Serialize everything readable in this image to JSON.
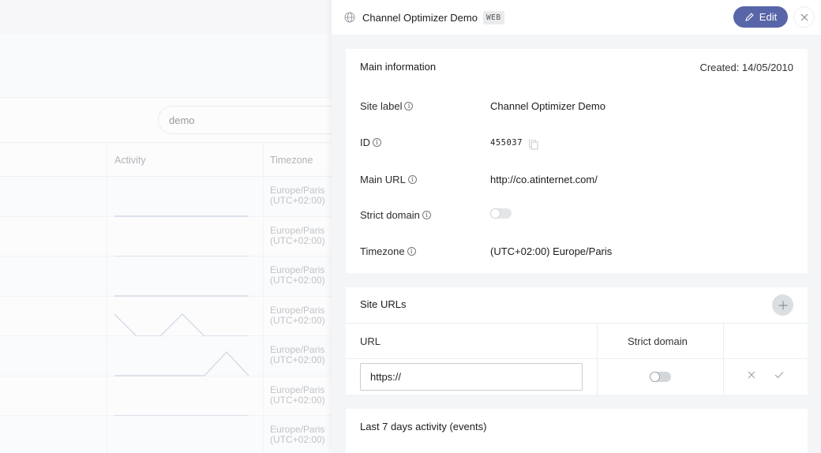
{
  "background": {
    "search_value": "demo",
    "columns": {
      "activity": "Activity",
      "timezone": "Timezone"
    },
    "rows": [
      {
        "timezone_line1": "Europe/Paris",
        "timezone_line2": "(UTC+02:00)"
      },
      {
        "timezone_line1": "Europe/Paris",
        "timezone_line2": "(UTC+02:00)"
      },
      {
        "timezone_line1": "Europe/Paris",
        "timezone_line2": "(UTC+02:00)"
      },
      {
        "timezone_line1": "Europe/Paris",
        "timezone_line2": "(UTC+02:00)"
      },
      {
        "timezone_line1": "Europe/Paris",
        "timezone_line2": "(UTC+02:00)"
      },
      {
        "timezone_line1": "Europe/Paris",
        "timezone_line2": "(UTC+02:00)"
      },
      {
        "timezone_line1": "Europe/Paris",
        "timezone_line2": "(UTC+02:00)"
      }
    ]
  },
  "panel": {
    "title": "Channel Optimizer Demo",
    "badge": "WEB",
    "edit_label": "Edit",
    "main": {
      "title": "Main information",
      "created": "Created: 14/05/2010",
      "fields": {
        "site_label": {
          "label": "Site label",
          "value": "Channel Optimizer Demo"
        },
        "id": {
          "label": "ID",
          "value": "455037"
        },
        "main_url": {
          "label": "Main URL",
          "value": "http://co.atinternet.com/"
        },
        "strict_domain": {
          "label": "Strict domain",
          "value": "off"
        },
        "timezone": {
          "label": "Timezone",
          "value": "(UTC+02:00) Europe/Paris"
        }
      }
    },
    "site_urls": {
      "title": "Site URLs",
      "col_url": "URL",
      "col_strict": "Strict domain",
      "input_value": "https://"
    },
    "activity": {
      "title": "Last 7 days activity (events)"
    }
  },
  "colors": {
    "accent": "#5865a9"
  }
}
